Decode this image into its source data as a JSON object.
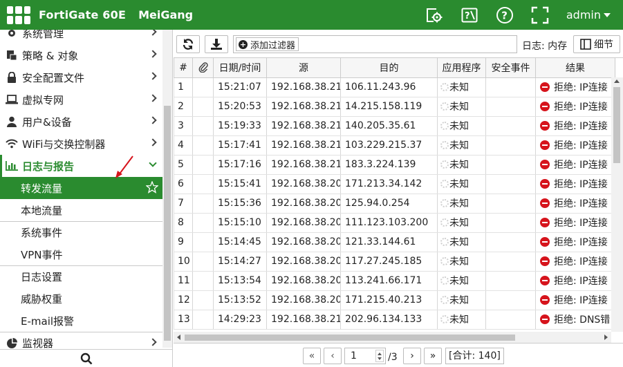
{
  "header": {
    "device": "FortiGate 60E",
    "hostname": "MeiGang",
    "user": "admin"
  },
  "sidebar": {
    "items": [
      {
        "label": "系统管理",
        "icon": "gear-icon"
      },
      {
        "label": "策略 & 对象",
        "icon": "policy-icon"
      },
      {
        "label": "安全配置文件",
        "icon": "lock-icon"
      },
      {
        "label": "虚拟专网",
        "icon": "laptop-icon"
      },
      {
        "label": "用户&设备",
        "icon": "user-icon"
      },
      {
        "label": "WiFi与交换控制器",
        "icon": "wifi-icon"
      },
      {
        "label": "日志与报告",
        "icon": "bar-chart-icon"
      }
    ],
    "subitems": [
      {
        "label": "转发流量"
      },
      {
        "label": "本地流量"
      },
      {
        "label": "系统事件"
      },
      {
        "label": "VPN事件"
      },
      {
        "label": "日志设置"
      },
      {
        "label": "威胁权重"
      },
      {
        "label": "E-mail报警"
      }
    ],
    "monitor": {
      "label": "监视器",
      "icon": "pie-chart-icon"
    }
  },
  "toolbar": {
    "add_filter": "添加过滤器",
    "log_source": "日志: 内存",
    "details": "细节"
  },
  "table": {
    "headers": [
      "#",
      "",
      "日期/时间",
      "源",
      "目的",
      "应用程序",
      "安全事件",
      "结果"
    ],
    "rows": [
      {
        "n": "1",
        "time": "15:21:07",
        "src": "192.168.38.21",
        "dst": "106.11.243.96",
        "app": "未知",
        "sec": "",
        "result": "拒绝: IP连接"
      },
      {
        "n": "2",
        "time": "15:20:53",
        "src": "192.168.38.21",
        "dst": "14.215.158.119",
        "app": "未知",
        "sec": "",
        "result": "拒绝: IP连接"
      },
      {
        "n": "3",
        "time": "15:19:33",
        "src": "192.168.38.21",
        "dst": "140.205.35.61",
        "app": "未知",
        "sec": "",
        "result": "拒绝: IP连接"
      },
      {
        "n": "4",
        "time": "15:17:41",
        "src": "192.168.38.21",
        "dst": "103.229.215.37",
        "app": "未知",
        "sec": "",
        "result": "拒绝: IP连接"
      },
      {
        "n": "5",
        "time": "15:17:16",
        "src": "192.168.38.21",
        "dst": "183.3.224.139",
        "app": "未知",
        "sec": "",
        "result": "拒绝: IP连接"
      },
      {
        "n": "6",
        "time": "15:15:41",
        "src": "192.168.38.20",
        "dst": "171.213.34.142",
        "app": "未知",
        "sec": "",
        "result": "拒绝: IP连接"
      },
      {
        "n": "7",
        "time": "15:15:36",
        "src": "192.168.38.20",
        "dst": "125.94.0.254",
        "app": "未知",
        "sec": "",
        "result": "拒绝: IP连接"
      },
      {
        "n": "8",
        "time": "15:15:10",
        "src": "192.168.38.20",
        "dst": "111.123.103.200",
        "app": "未知",
        "sec": "",
        "result": "拒绝: IP连接"
      },
      {
        "n": "9",
        "time": "15:14:45",
        "src": "192.168.38.20",
        "dst": "121.33.144.61",
        "app": "未知",
        "sec": "",
        "result": "拒绝: IP连接"
      },
      {
        "n": "10",
        "time": "15:14:27",
        "src": "192.168.38.20",
        "dst": "117.27.245.185",
        "app": "未知",
        "sec": "",
        "result": "拒绝: IP连接"
      },
      {
        "n": "11",
        "time": "15:13:54",
        "src": "192.168.38.20",
        "dst": "113.241.66.171",
        "app": "未知",
        "sec": "",
        "result": "拒绝: IP连接"
      },
      {
        "n": "12",
        "time": "15:13:52",
        "src": "192.168.38.20",
        "dst": "171.215.40.213",
        "app": "未知",
        "sec": "",
        "result": "拒绝: IP连接"
      },
      {
        "n": "13",
        "time": "14:29:23",
        "src": "192.168.38.21",
        "dst": "202.96.134.133",
        "app": "未知",
        "sec": "",
        "result": "拒绝: DNS错"
      }
    ]
  },
  "pager": {
    "page": "1",
    "total_pages": "/3",
    "total": "[合计: 140]"
  },
  "colors": {
    "brand": "#2a8b2f",
    "deny": "#d6141c"
  }
}
